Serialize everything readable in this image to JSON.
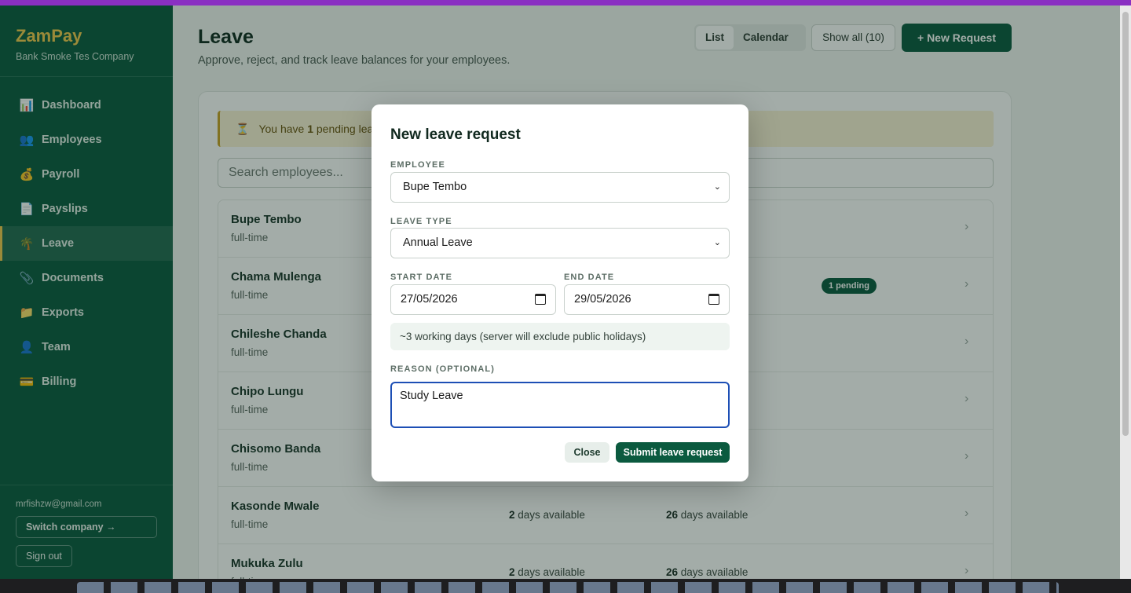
{
  "sidebar": {
    "brand": "ZamPay",
    "company": "Bank Smoke Tes Company",
    "items": [
      {
        "icon": "📊",
        "label": "Dashboard"
      },
      {
        "icon": "👥",
        "label": "Employees"
      },
      {
        "icon": "💰",
        "label": "Payroll"
      },
      {
        "icon": "📄",
        "label": "Payslips"
      },
      {
        "icon": "🌴",
        "label": "Leave"
      },
      {
        "icon": "📎",
        "label": "Documents"
      },
      {
        "icon": "📁",
        "label": "Exports"
      },
      {
        "icon": "👤",
        "label": "Team"
      },
      {
        "icon": "💳",
        "label": "Billing"
      }
    ],
    "email": "mrfishzw@gmail.com",
    "switch_label": "Switch company →",
    "signout_label": "Sign out"
  },
  "header": {
    "title": "Leave",
    "subtitle": "Approve, reject, and track leave balances for your employees.",
    "view_list": "List",
    "view_calendar": "Calendar",
    "show_all": "Show all (10)",
    "new_request": "+ New Request"
  },
  "alert": {
    "prefix": "You have ",
    "count": "1",
    "suffix": " pending lea"
  },
  "search": {
    "placeholder": "Search employees..."
  },
  "employees": [
    {
      "name": "Bupe Tembo",
      "type": "full-time",
      "annual": "",
      "sick": "",
      "badge": ""
    },
    {
      "name": "Chama Mulenga",
      "type": "full-time",
      "annual": "",
      "sick": "",
      "badge": "1 pending"
    },
    {
      "name": "Chileshe Chanda",
      "type": "full-time",
      "annual": "",
      "sick": "",
      "badge": ""
    },
    {
      "name": "Chipo Lungu",
      "type": "full-time",
      "annual": "",
      "sick": "",
      "badge": ""
    },
    {
      "name": "Chisomo Banda",
      "type": "full-time",
      "annual": "",
      "sick": "",
      "badge": ""
    },
    {
      "name": "Kasonde Mwale",
      "type": "full-time",
      "annual": "2",
      "sick": "26",
      "badge": ""
    },
    {
      "name": "Mukuka Zulu",
      "type": "full-time",
      "annual": "2",
      "sick": "26",
      "badge": ""
    }
  ],
  "avail_suffix": " days available",
  "modal": {
    "title": "New leave request",
    "employee_label": "EMPLOYEE",
    "employee_value": "Bupe Tembo",
    "leave_type_label": "LEAVE TYPE",
    "leave_type_value": "Annual Leave",
    "start_label": "START DATE",
    "start_value": "27/05/2026",
    "end_label": "END DATE",
    "end_value": "29/05/2026",
    "hint": "~3 working days (server will exclude public holidays)",
    "reason_label": "REASON (OPTIONAL)",
    "reason_value": "Study Leave",
    "close": "Close",
    "submit": "Submit leave request"
  }
}
